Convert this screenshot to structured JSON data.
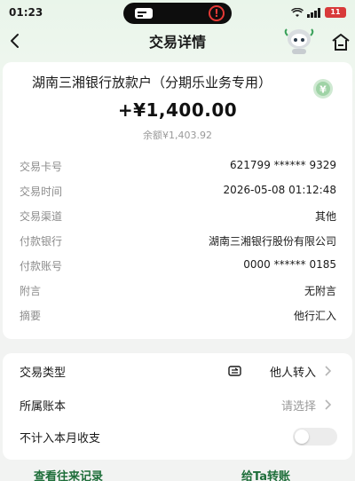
{
  "status_bar": {
    "time": "01:23",
    "battery": "11"
  },
  "header": {
    "title": "交易详情"
  },
  "transaction": {
    "account_name": "湖南三湘银行放款户（分期乐业务专用）",
    "amount": "+¥1,400.00",
    "balance": "余额¥1,403.92",
    "details": [
      {
        "label": "交易卡号",
        "value": "621799 ****** 9329"
      },
      {
        "label": "交易时间",
        "value": "2026-05-08 01:12:48"
      },
      {
        "label": "交易渠道",
        "value": "其他"
      },
      {
        "label": "付款银行",
        "value": "湖南三湘银行股份有限公司"
      },
      {
        "label": "付款账号",
        "value": "0000 ****** 0185"
      },
      {
        "label": "附言",
        "value": "无附言"
      },
      {
        "label": "摘要",
        "value": "他行汇入"
      }
    ]
  },
  "options": {
    "type_label": "交易类型",
    "type_value": "他人转入",
    "book_label": "所属账本",
    "book_value": "请选择",
    "exclude_label": "不计入本月收支"
  },
  "actions": {
    "history": "查看往来记录",
    "transfer": "给Ta转账"
  },
  "colors": {
    "accent": "#1e6e3a",
    "alert": "#e53935"
  }
}
